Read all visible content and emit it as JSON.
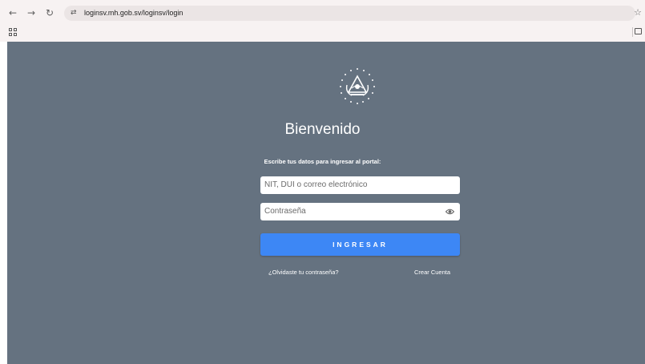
{
  "browser": {
    "url": "loginsv.mh.gob.sv/loginsv/login",
    "back_icon": "back-arrow-icon",
    "forward_icon": "forward-arrow-icon",
    "reload_icon": "reload-icon",
    "site_info_icon": "tune-icon",
    "bookmark_icon": "star-icon",
    "apps_icon": "apps-grid-icon",
    "folder_icon": "folder-icon"
  },
  "login": {
    "logo": "el-salvador-seal",
    "title": "Bienvenido",
    "subtitle": "Escribe tus datos para ingresar al portal:",
    "user_placeholder": "NIT, DUI o correo electrónico",
    "password_placeholder": "Contraseña",
    "submit_label": "INGRESAR",
    "forgot_link": "¿Olvidaste tu contraseña?",
    "create_link": "Crear Cuenta"
  },
  "colors": {
    "page_background": "#657280",
    "button": "#3d87f5",
    "browser_chrome": "#f7f2f2"
  }
}
